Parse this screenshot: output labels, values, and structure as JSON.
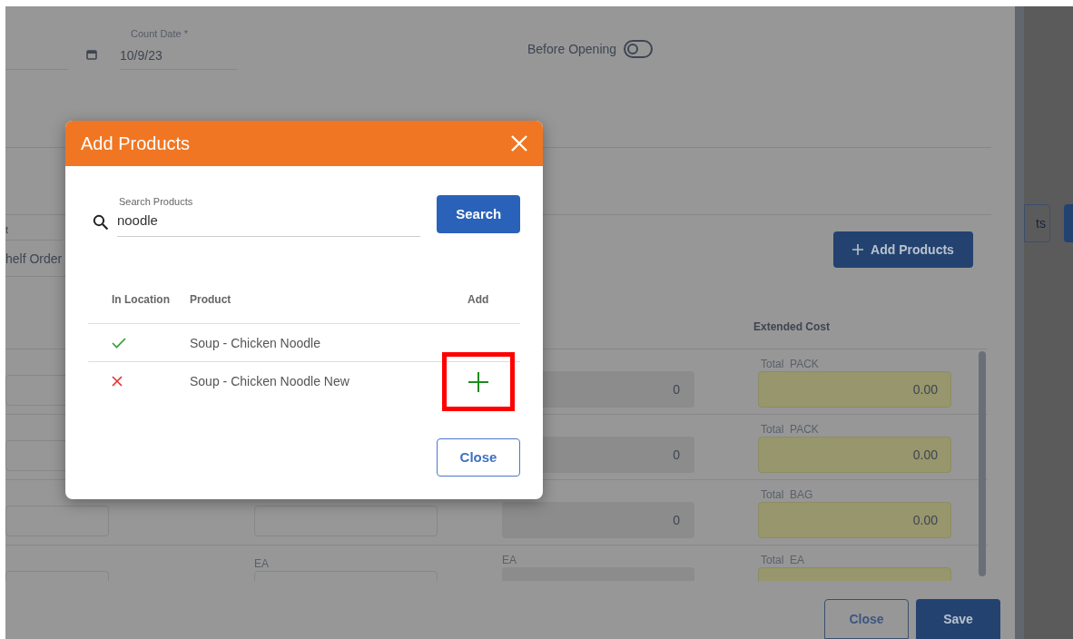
{
  "page": {
    "count_date": {
      "label": "Count Date *",
      "value": "10/9/23"
    },
    "before_opening": {
      "label": "Before Opening",
      "on": false
    },
    "shelf_field": {
      "label": "t",
      "value": "helf Order"
    },
    "add_products_button": "Add Products",
    "side_button": "ts",
    "columns": [
      "Extended Cost"
    ],
    "rows": [
      {
        "count": "0",
        "total_label": "Total  PACK",
        "total": "0.00"
      },
      {
        "count": "0",
        "total_label": "Total  PACK",
        "total": "0.00"
      },
      {
        "count": "0",
        "total_label": "Total  BAG",
        "total": "0.00"
      },
      {
        "unit_label": "EA",
        "count_label": "EA",
        "total_label": "Total  EA"
      }
    ],
    "buttons": [
      {
        "label": "Close",
        "kind": "outline"
      },
      {
        "label": "Save",
        "kind": "primary"
      }
    ]
  },
  "dialog": {
    "title": "Add Products",
    "search": {
      "label": "Search Products",
      "value": "noodle"
    },
    "search_button": "Search",
    "columns": [
      "In Location",
      "Product",
      "Add"
    ],
    "rows": [
      {
        "in_location": true,
        "product": "Soup - Chicken Noodle",
        "addable": false,
        "highlighted": false
      },
      {
        "in_location": false,
        "product": "Soup - Chicken Noodle New",
        "addable": true,
        "highlighted": true
      }
    ],
    "close_button": "Close"
  }
}
